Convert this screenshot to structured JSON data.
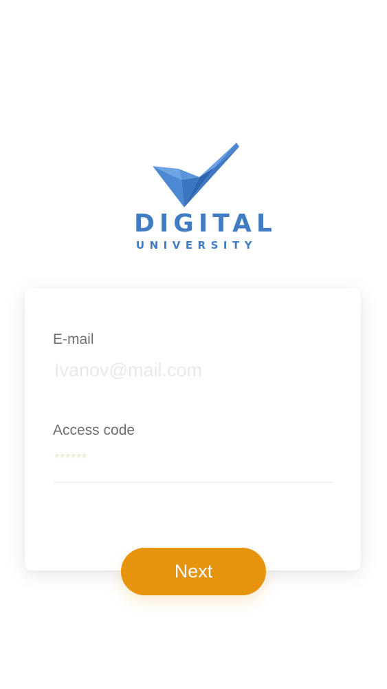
{
  "logo": {
    "line1": "DIGITAL",
    "line2": "UNIVERSITY",
    "icon": "checkmark-logo-icon",
    "color": "#3f7cc4"
  },
  "form": {
    "email_label": "E-mail",
    "email_placeholder": "Ivanov@mail.com",
    "email_value": "",
    "code_label": "Access code",
    "code_placeholder": "******",
    "code_value": ""
  },
  "actions": {
    "next_label": "Next",
    "accent": "#e6930e"
  }
}
